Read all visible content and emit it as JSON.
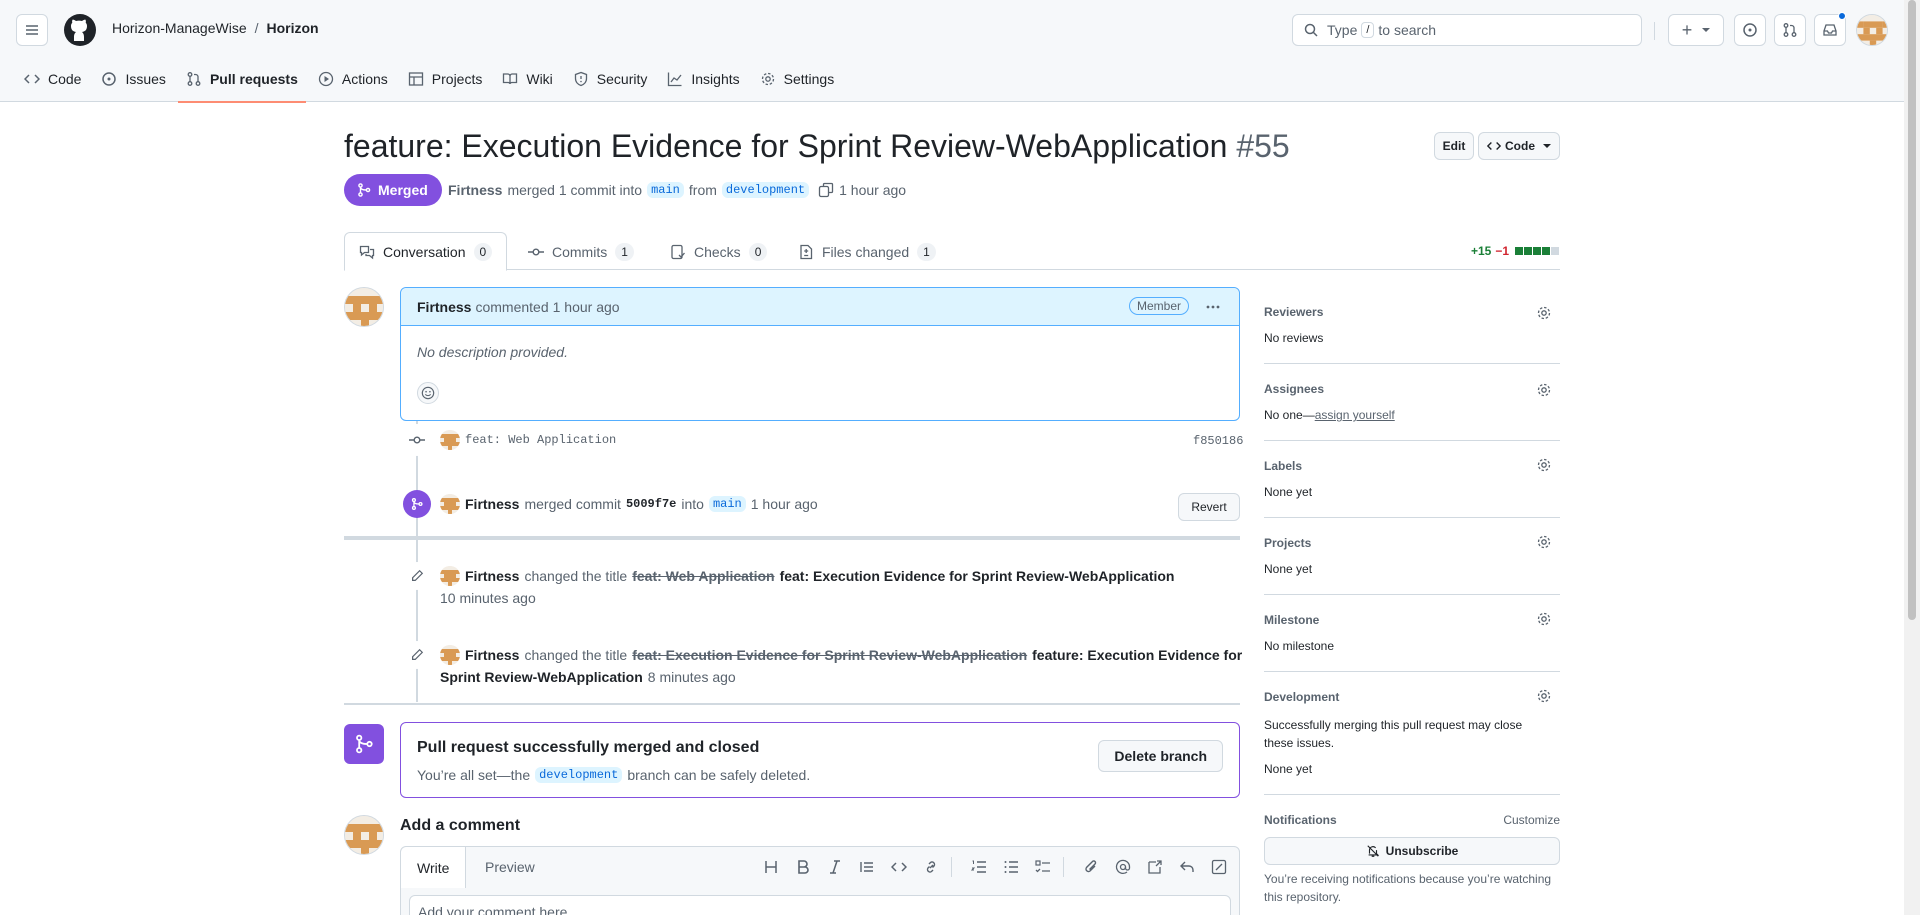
{
  "header": {
    "owner": "Horizon-ManageWise",
    "separator": "/",
    "repo": "Horizon",
    "search_prefix": "Type",
    "search_key": "/",
    "search_suffix": "to search",
    "add_label": "+"
  },
  "repo_nav": [
    {
      "label": "Code",
      "icon": "code-icon"
    },
    {
      "label": "Issues",
      "icon": "issue-icon"
    },
    {
      "label": "Pull requests",
      "icon": "pull-request-icon",
      "active": true
    },
    {
      "label": "Actions",
      "icon": "play-icon"
    },
    {
      "label": "Projects",
      "icon": "table-icon"
    },
    {
      "label": "Wiki",
      "icon": "book-icon"
    },
    {
      "label": "Security",
      "icon": "shield-icon"
    },
    {
      "label": "Insights",
      "icon": "graph-icon"
    },
    {
      "label": "Settings",
      "icon": "gear-icon"
    }
  ],
  "pr": {
    "title": "feature: Execution Evidence for Sprint Review-WebApplication",
    "number": "#55",
    "edit_label": "Edit",
    "code_label": "Code",
    "status": "Merged",
    "author": "Firtness",
    "merged_text": "merged 1 commit into",
    "base_branch": "main",
    "from_text": "from",
    "head_branch": "development",
    "time": "1 hour ago"
  },
  "tabs": [
    {
      "label": "Conversation",
      "count": "0",
      "active": true
    },
    {
      "label": "Commits",
      "count": "1"
    },
    {
      "label": "Checks",
      "count": "0"
    },
    {
      "label": "Files changed",
      "count": "1"
    }
  ],
  "diffstat": {
    "additions": "+15",
    "deletions": "−1",
    "add_blocks": 4,
    "neutral_blocks": 1
  },
  "comment": {
    "author": "Firtness",
    "action": "commented",
    "time": "1 hour ago",
    "badge": "Member",
    "body": "No description provided."
  },
  "commit_event": {
    "message": "feat: Web Application",
    "sha": "f850186"
  },
  "merge_event": {
    "author": "Firtness",
    "text": "merged commit",
    "sha": "5009f7e",
    "into": "into",
    "branch": "main",
    "time": "1 hour ago",
    "revert_label": "Revert"
  },
  "rename_events": [
    {
      "author": "Firtness",
      "text": "changed the title",
      "old": "feat: Web Application",
      "new": "feat: Execution Evidence for Sprint Review-WebApplication",
      "time": "10 minutes ago"
    },
    {
      "author": "Firtness",
      "text": "changed the title",
      "old": "feat: Execution Evidence for Sprint Review-WebApplication",
      "new_line1": "feature: Execution Evidence for",
      "new_line2": "Sprint Review-WebApplication",
      "time": "8 minutes ago"
    }
  ],
  "merged_box": {
    "title": "Pull request successfully merged and closed",
    "sub_prefix": "You’re all set—the",
    "branch": "development",
    "sub_suffix": "branch can be safely deleted.",
    "delete_label": "Delete branch"
  },
  "add_comment": {
    "title": "Add a comment",
    "write_tab": "Write",
    "preview_tab": "Preview",
    "placeholder": "Add your comment here..."
  },
  "sidebar": {
    "reviewers": {
      "label": "Reviewers",
      "value": "No reviews"
    },
    "assignees": {
      "label": "Assignees",
      "value": "No one—",
      "link": "assign yourself"
    },
    "labels": {
      "label": "Labels",
      "value": "None yet"
    },
    "projects": {
      "label": "Projects",
      "value": "None yet"
    },
    "milestone": {
      "label": "Milestone",
      "value": "No milestone"
    },
    "development": {
      "label": "Development",
      "desc": "Successfully merging this pull request may close these issues.",
      "value": "None yet"
    },
    "notifications": {
      "label": "Notifications",
      "customize": "Customize",
      "unsubscribe": "Unsubscribe",
      "reason": "You’re receiving notifications because you’re watching this repository."
    }
  },
  "colors": {
    "merged": "#8250df",
    "accent": "#0969da",
    "nav_underline": "#fd8c73",
    "add": "#1a7f37"
  }
}
